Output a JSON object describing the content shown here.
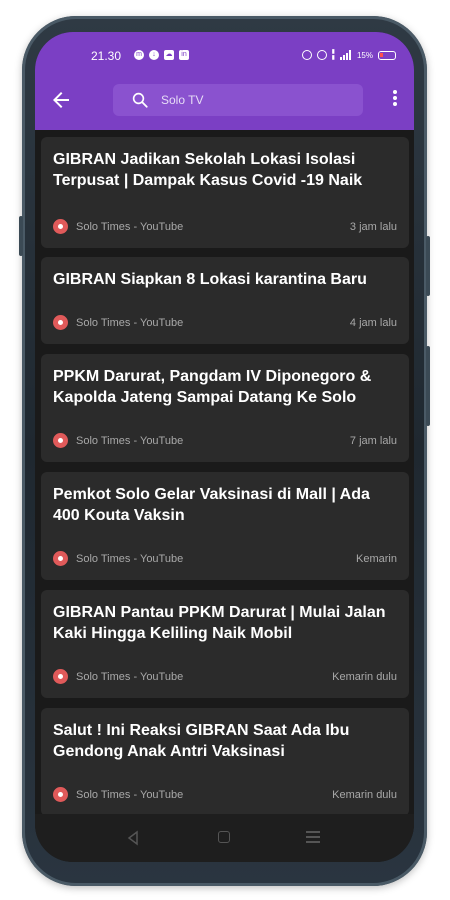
{
  "status": {
    "time": "21.30",
    "battery": "15%"
  },
  "search": {
    "query": "Solo TV"
  },
  "feed": [
    {
      "title": "GIBRAN Jadikan Sekolah Lokasi Isolasi Terpusat | Dampak Kasus Covid -19 Naik",
      "source": "Solo Times - YouTube",
      "time": "3 jam lalu"
    },
    {
      "title": "GIBRAN Siapkan 8 Lokasi karantina Baru",
      "source": "Solo Times - YouTube",
      "time": "4 jam lalu"
    },
    {
      "title": "PPKM Darurat, Pangdam IV Diponegoro & Kapolda Jateng Sampai Datang Ke Solo",
      "source": "Solo Times - YouTube",
      "time": "7 jam lalu"
    },
    {
      "title": "Pemkot Solo Gelar Vaksinasi di Mall | Ada 400 Kouta Vaksin",
      "source": "Solo Times - YouTube",
      "time": "Kemarin"
    },
    {
      "title": "GIBRAN Pantau PPKM Darurat | Mulai Jalan Kaki Hingga Keliling Naik Mobil",
      "source": "Solo Times - YouTube",
      "time": "Kemarin dulu"
    },
    {
      "title": "Salut ! Ini Reaksi GIBRAN Saat Ada Ibu Gendong Anak Antri Vaksinasi",
      "source": "Solo Times - YouTube",
      "time": "Kemarin dulu"
    }
  ],
  "colors": {
    "accent": "#7b3fc4",
    "card": "#2b2b2b",
    "background": "#1a1a1a"
  }
}
